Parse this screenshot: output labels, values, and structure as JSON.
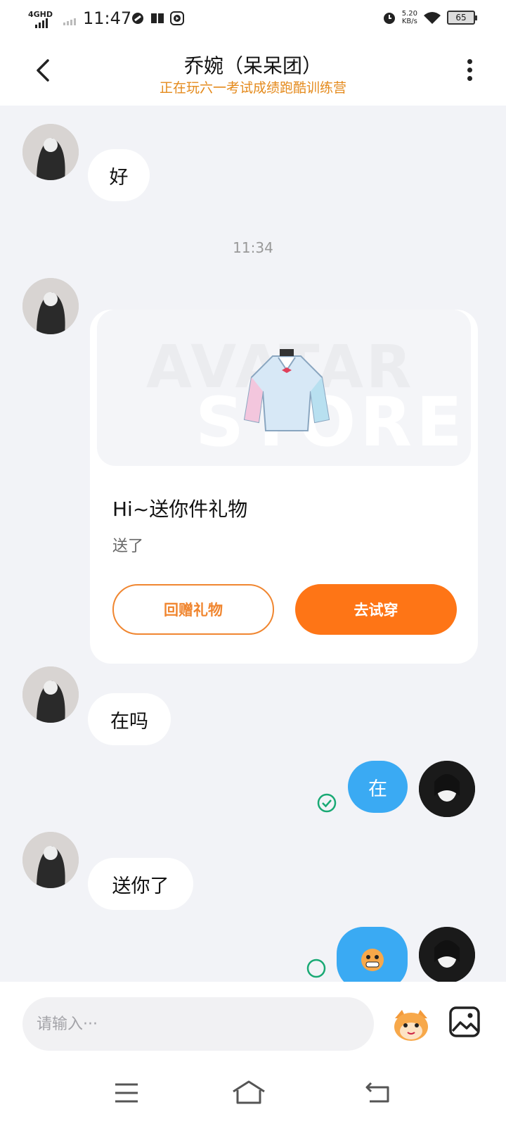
{
  "status_bar": {
    "network": "4GHD",
    "time": "11:47",
    "speed_value": "5.20",
    "speed_unit": "KB/s",
    "battery": "65"
  },
  "header": {
    "title": "乔婉（呆呆团）",
    "subtitle": "正在玩六一考试成绩跑酷训练营"
  },
  "messages": [
    {
      "from": "other",
      "type": "text",
      "text": "好"
    },
    {
      "type": "timestamp",
      "text": "11:34"
    },
    {
      "from": "other",
      "type": "gift",
      "banner_text": [
        "AVATAR",
        "STORE"
      ],
      "title": "Hi~送你件礼物",
      "desc": "送了",
      "btn_return": "回赠礼物",
      "btn_try": "去试穿"
    },
    {
      "from": "other",
      "type": "text",
      "text": "在吗"
    },
    {
      "from": "me",
      "type": "text",
      "text": "在",
      "read": true
    },
    {
      "from": "other",
      "type": "text",
      "text": "送你了"
    },
    {
      "from": "me",
      "type": "sticker",
      "read": true
    }
  ],
  "input": {
    "placeholder": "请输入···"
  },
  "colors": {
    "accent_orange": "#fe7516",
    "subtitle_orange": "#e48a1c",
    "my_bubble": "#3aaaf3",
    "read_green": "#19a974"
  }
}
